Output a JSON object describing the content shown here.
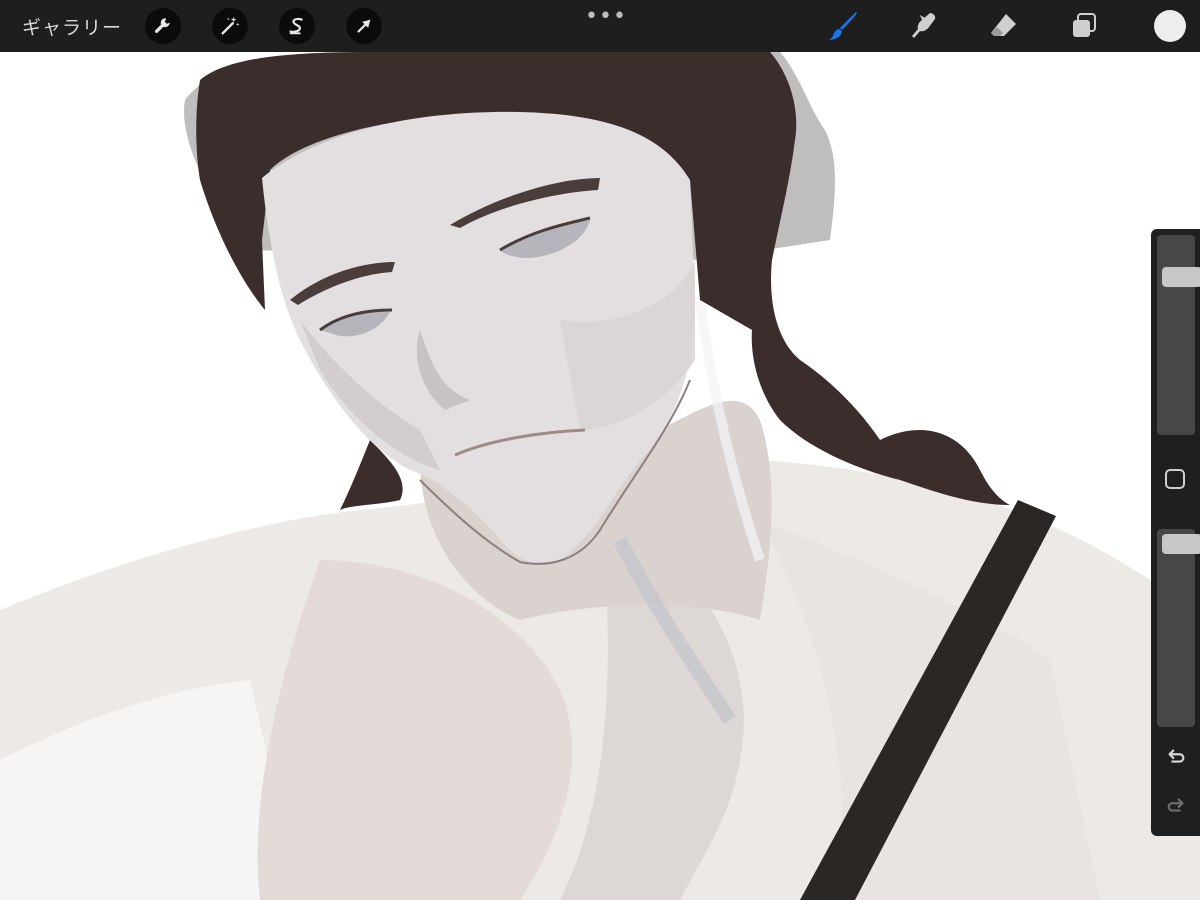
{
  "toolbar": {
    "gallery_label": "ギャラリー",
    "more_label": "•••",
    "left_tools": [
      "wrench-icon",
      "magic-wand-icon",
      "selection-icon",
      "transform-arrow-icon"
    ],
    "right_tools": [
      "brush-icon",
      "smudge-icon",
      "eraser-icon",
      "layers-icon"
    ],
    "active_tool": "brush",
    "accent_color": "#1a73e8",
    "current_color": "#ededed"
  },
  "sidebar": {
    "brush_size_level": 0.82,
    "brush_opacity_level": 0.97,
    "modify_icon": "square-outline-icon",
    "undo_icon": "undo-arrow-icon",
    "redo_icon": "redo-arrow-icon"
  }
}
